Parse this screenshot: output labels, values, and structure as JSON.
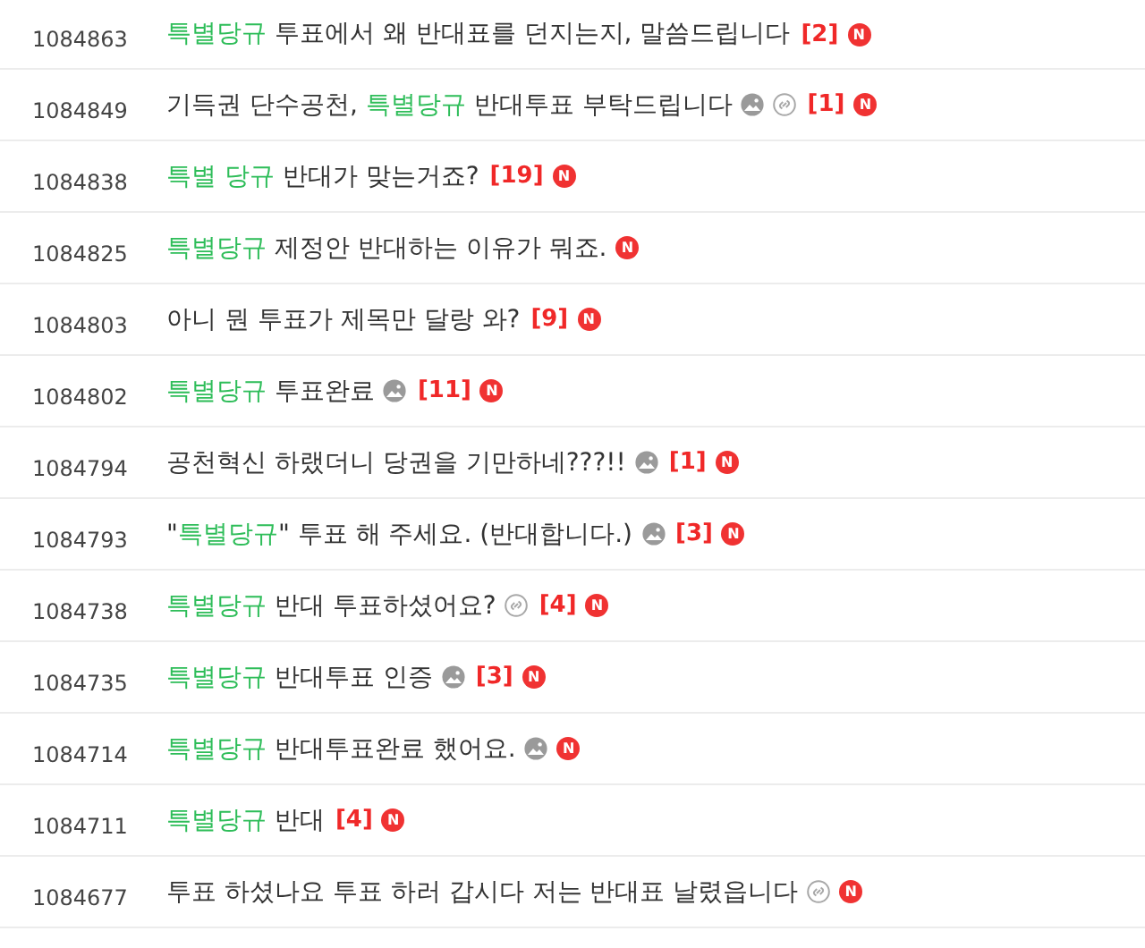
{
  "posts": [
    {
      "number": "1084863",
      "title": [
        {
          "text": "특별당규",
          "highlighted": true
        },
        {
          "text": " 투표에서 왜 반대표를 던지는지, 말씀드립니다",
          "highlighted": false
        }
      ],
      "has_image": false,
      "has_link": false,
      "comments": "[2]",
      "badge": "N"
    },
    {
      "number": "1084849",
      "title": [
        {
          "text": "기득권 단수공천, ",
          "highlighted": false
        },
        {
          "text": "특별당규",
          "highlighted": true
        },
        {
          "text": " 반대투표 부탁드립니다",
          "highlighted": false
        }
      ],
      "has_image": true,
      "has_link": true,
      "comments": "[1]",
      "badge": "N"
    },
    {
      "number": "1084838",
      "title": [
        {
          "text": "특별 당규",
          "highlighted": true
        },
        {
          "text": " 반대가 맞는거죠?",
          "highlighted": false
        }
      ],
      "has_image": false,
      "has_link": false,
      "comments": "[19]",
      "badge": "N"
    },
    {
      "number": "1084825",
      "title": [
        {
          "text": "특별당규",
          "highlighted": true
        },
        {
          "text": " 제정안 반대하는 이유가 뭐죠.",
          "highlighted": false
        }
      ],
      "has_image": false,
      "has_link": false,
      "badge": "N"
    },
    {
      "number": "1084803",
      "title": [
        {
          "text": "아니 뭔 투표가 제목만 달랑 와?",
          "highlighted": false
        }
      ],
      "has_image": false,
      "has_link": false,
      "comments": "[9]",
      "badge": "N"
    },
    {
      "number": "1084802",
      "title": [
        {
          "text": "특별당규",
          "highlighted": true
        },
        {
          "text": " 투표완료",
          "highlighted": false
        }
      ],
      "has_image": true,
      "has_link": false,
      "comments": "[11]",
      "badge": "N"
    },
    {
      "number": "1084794",
      "title": [
        {
          "text": "공천혁신 하랬더니 당권을 기만하네???!!",
          "highlighted": false
        }
      ],
      "has_image": true,
      "has_link": false,
      "comments": "[1]",
      "badge": "N"
    },
    {
      "number": "1084793",
      "title": [
        {
          "text": "\"",
          "highlighted": false
        },
        {
          "text": "특별당규",
          "highlighted": true
        },
        {
          "text": "\" 투표 해 주세요. (반대합니다.)",
          "highlighted": false
        }
      ],
      "has_image": true,
      "has_link": false,
      "comments": "[3]",
      "badge": "N"
    },
    {
      "number": "1084738",
      "title": [
        {
          "text": "특별당규",
          "highlighted": true
        },
        {
          "text": " 반대 투표하셨어요?",
          "highlighted": false
        }
      ],
      "has_image": false,
      "has_link": true,
      "comments": "[4]",
      "badge": "N"
    },
    {
      "number": "1084735",
      "title": [
        {
          "text": "특별당규",
          "highlighted": true
        },
        {
          "text": " 반대투표 인증",
          "highlighted": false
        }
      ],
      "has_image": true,
      "has_link": false,
      "comments": "[3]",
      "badge": "N"
    },
    {
      "number": "1084714",
      "title": [
        {
          "text": "특별당규",
          "highlighted": true
        },
        {
          "text": " 반대투표완료 했어요.",
          "highlighted": false
        }
      ],
      "has_image": true,
      "has_link": false,
      "badge": "N"
    },
    {
      "number": "1084711",
      "title": [
        {
          "text": "특별당규",
          "highlighted": true
        },
        {
          "text": " 반대",
          "highlighted": false
        }
      ],
      "has_image": false,
      "has_link": false,
      "comments": "[4]",
      "badge": "N"
    },
    {
      "number": "1084677",
      "title": [
        {
          "text": "투표 하셨나요 투표 하러 갑시다 저는 반대표 날렸읍니다",
          "highlighted": false
        }
      ],
      "has_image": false,
      "has_link": true,
      "badge": "N"
    }
  ]
}
